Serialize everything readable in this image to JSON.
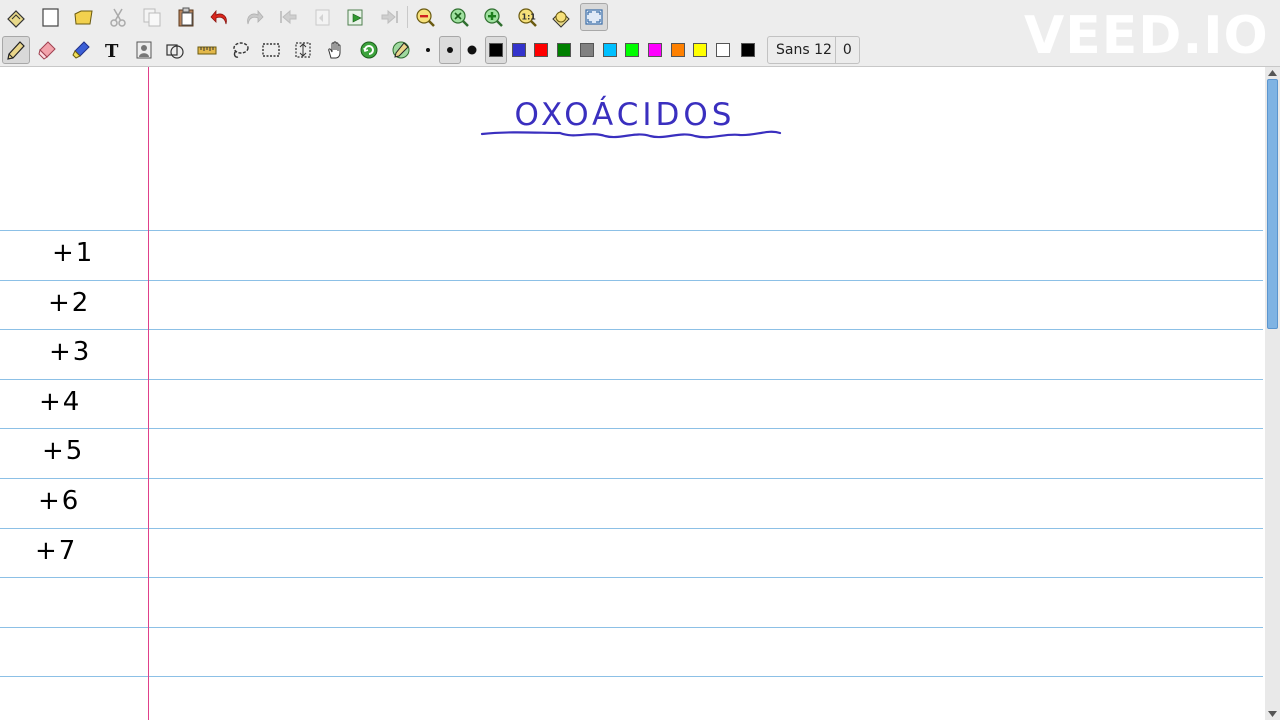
{
  "toolbar": {
    "row1_icons": [
      "new-document-icon",
      "new-page-icon",
      "open-folder-icon",
      "cut-icon",
      "copy-icon",
      "paste-icon",
      "undo-icon",
      "redo-icon",
      "first-page-icon",
      "previous-page-icon",
      "next-page-icon",
      "last-page-icon",
      "zoom-out-icon",
      "zoom-fit-icon",
      "zoom-in-icon",
      "zoom-100-icon",
      "annotate-pdf-icon",
      "fullscreen-icon"
    ],
    "row2_tools": [
      "pen-icon",
      "eraser-icon",
      "highlighter-icon",
      "text-icon",
      "image-icon",
      "shape-recognizer-icon",
      "ruler-icon",
      "lasso-select-icon",
      "rectangle-select-icon",
      "vertical-space-icon",
      "hand-icon",
      "default-tool-icon",
      "hand-shape-icon"
    ],
    "pen_sizes": [
      "thin",
      "medium",
      "thick"
    ],
    "colors": [
      "#000000",
      "#3333cc",
      "#ff0000",
      "#008000",
      "#808080",
      "#00c0ff",
      "#00ff00",
      "#ff00ff",
      "#ff8000",
      "#ffff00",
      "#ffffff"
    ],
    "current_color": "#000000",
    "font_name": "Sans 12",
    "font_value": "0"
  },
  "watermark": "VEED.IO",
  "page": {
    "title": "OXOÁCIDOS",
    "title_color": "#3a2fbf",
    "rule_color": "#8cc0e6",
    "margin_color": "#e0408a",
    "oxidation_states": [
      "+1",
      "+2",
      "+3",
      "+4",
      "+5",
      "+6",
      "+7"
    ],
    "ink_color": "#000000"
  }
}
